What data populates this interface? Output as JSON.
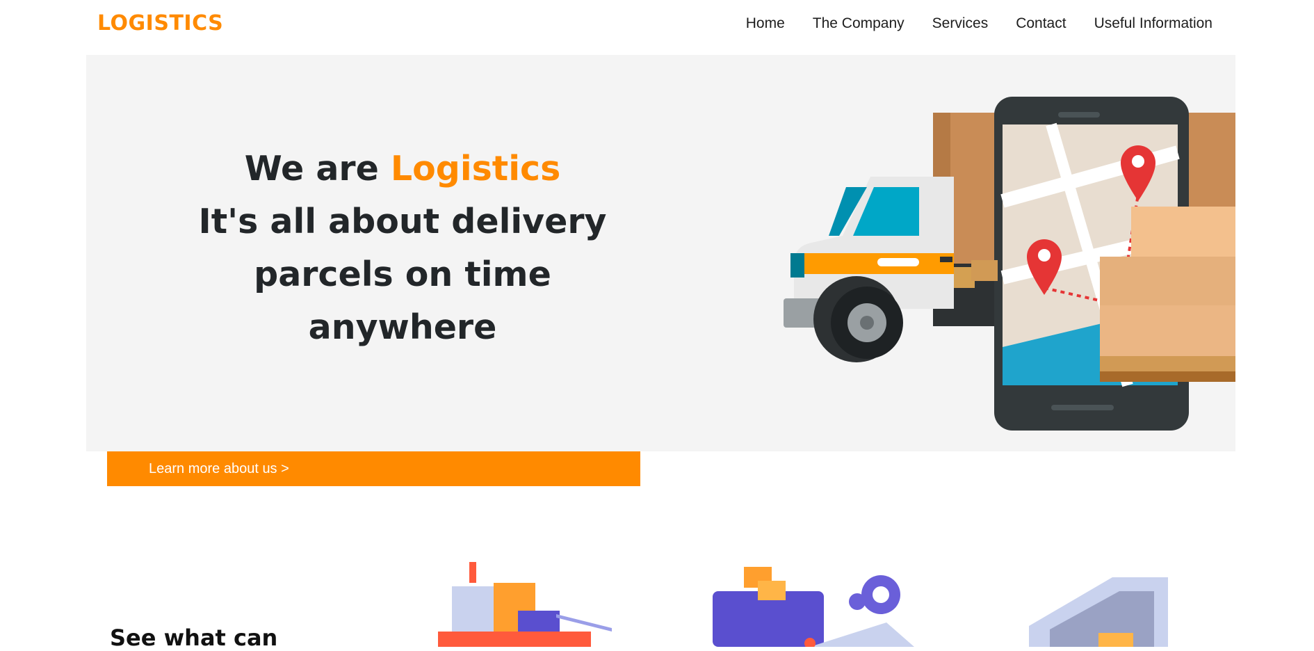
{
  "header": {
    "logo": "LOGISTICS",
    "nav": [
      "Home",
      "The Company",
      "Services",
      "Contact",
      "Useful Information"
    ]
  },
  "hero": {
    "line1_prefix": "We are ",
    "line1_accent": "Logistics",
    "line2": "It's all about delivery",
    "line3": "parcels on time",
    "line4": "anywhere",
    "cta_label": "Learn more about us  >"
  },
  "section": {
    "heading": "See what can"
  },
  "colors": {
    "accent": "#ff8a00",
    "hero_bg": "#f4f4f4",
    "text_dark": "#222629"
  }
}
